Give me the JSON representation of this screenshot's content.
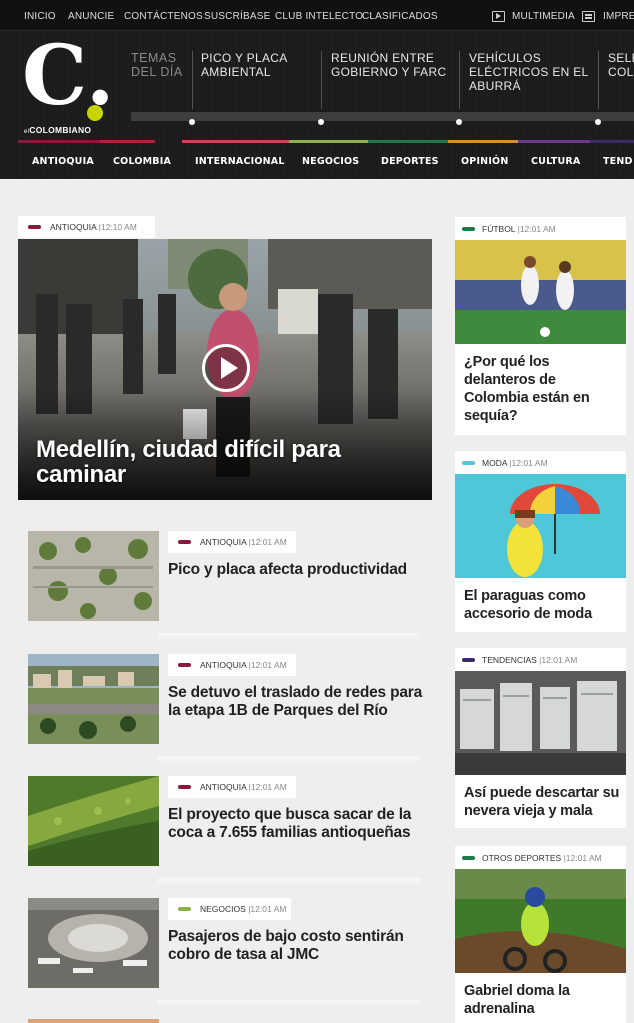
{
  "topnav": {
    "links": [
      "INICIO",
      "ANUNCIE",
      "CONTÁCTENOS",
      "SUSCRÍBASE",
      "CLUB INTELECTO",
      "CLASIFICADOS"
    ],
    "multimedia": "MULTIMEDIA",
    "print": "IMPRES"
  },
  "logo": {
    "letter": "C.",
    "brand_prefix": "el",
    "brand": "COLOMBIANO"
  },
  "temas": {
    "label": "TEMAS DEL DÍA",
    "items": [
      "PICO Y PLACA AMBIENTAL",
      "REUNIÓN ENTRE GOBIERNO Y FARC",
      "VEHÍCULOS ELÉCTRICOS EN EL ABURRÁ",
      "SELE COLO"
    ]
  },
  "sections": [
    {
      "label": "ANTIOQUIA",
      "color": "#8b1a3a"
    },
    {
      "label": "COLOMBIA",
      "color": "#b0223c"
    },
    {
      "label": "INTERNACIONAL",
      "color": "#c8465a"
    },
    {
      "label": "NEGOCIOS",
      "color": "#8cb04a"
    },
    {
      "label": "DEPORTES",
      "color": "#1f7a4a"
    },
    {
      "label": "OPINIÓN",
      "color": "#e08a2a"
    },
    {
      "label": "CULTURA",
      "color": "#6a3a8a"
    },
    {
      "label": "TEND",
      "color": "#3a2a6a"
    }
  ],
  "feature": {
    "section": "ANTIOQUIA",
    "time": "12:10 AM",
    "color": "#8b1a3a",
    "title": "Medellín, ciudad difícil para caminar"
  },
  "list": [
    {
      "section": "ANTIOQUIA",
      "time": "12:01 AM",
      "color": "#8b1a3a",
      "title": "Pico y placa afecta productividad"
    },
    {
      "section": "ANTIOQUIA",
      "time": "12:01 AM",
      "color": "#8b1a3a",
      "title": "Se detuvo el traslado de redes para la etapa 1B de Parques del Río"
    },
    {
      "section": "ANTIOQUIA",
      "time": "12:01 AM",
      "color": "#8b1a3a",
      "title": "El proyecto que busca sacar de la coca a 7.655 familias antioqueñas"
    },
    {
      "section": "NEGOCIOS",
      "time": "12:01 AM",
      "color": "#8cb04a",
      "title": "Pasajeros de bajo costo sentirán cobro de tasa al JMC"
    }
  ],
  "sidebar": [
    {
      "section": "FÚTBOL",
      "time": "12:01 AM",
      "color": "#1f7a4a",
      "title": "¿Por qué los delanteros de Colombia están en sequía?"
    },
    {
      "section": "MODA",
      "time": "12:01 AM",
      "color": "#5bc0d8",
      "title": "El paraguas como accesorio de moda"
    },
    {
      "section": "TENDENCIAS",
      "time": "12:01 AM",
      "color": "#3a2a6a",
      "title": "Así puede descartar su nevera vieja y mala"
    },
    {
      "section": "OTROS DEPORTES",
      "time": "12:01 AM",
      "color": "#1f7a4a",
      "title": "Gabriel doma la adrenalina"
    }
  ]
}
